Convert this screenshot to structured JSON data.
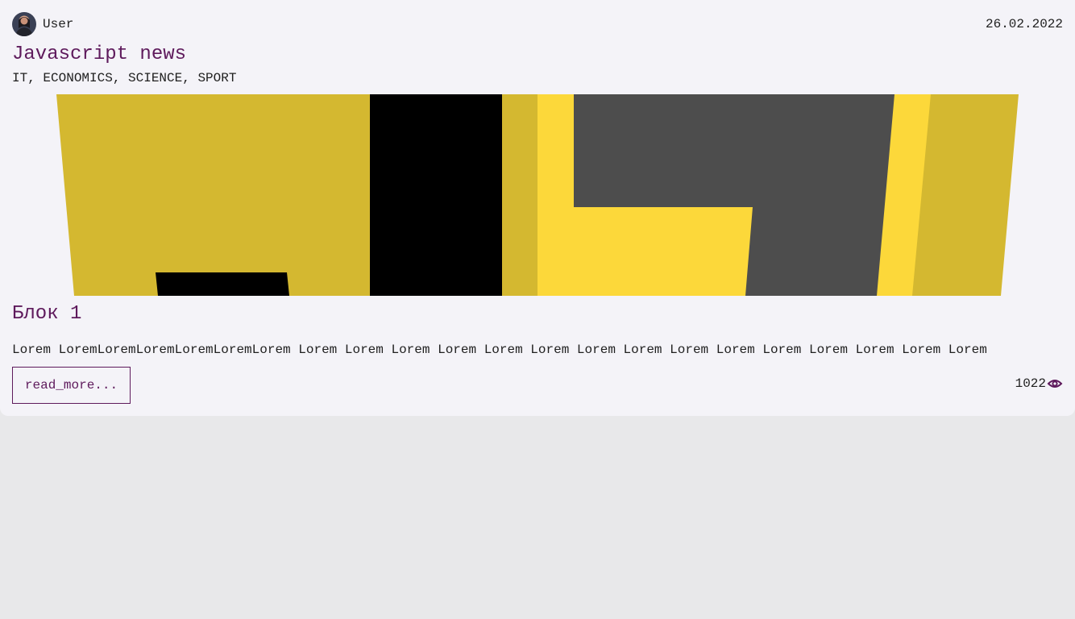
{
  "post": {
    "author": "User",
    "date": "26.02.2022",
    "title": "Javascript news",
    "tags": "IT, ECONOMICS, SCIENCE, SPORT",
    "block_title": "Блок 1",
    "text": "Lorem LoremLoremLoremLoremLoremLorem Lorem Lorem Lorem Lorem Lorem Lorem Lorem Lorem Lorem Lorem Lorem Lorem Lorem Lorem Lorem",
    "read_more_label": "read_more...",
    "views": "1022"
  },
  "icons": {
    "avatar": "avatar-image",
    "views": "eye-icon",
    "banner": "javascript-logo-image"
  },
  "colors": {
    "accent": "#5e1a5c",
    "banner_yellow": "#d4b830",
    "banner_bright_yellow": "#fcd83a",
    "banner_dark": "#4d4d4d",
    "background": "#e8e8ea",
    "card": "#f4f3f8"
  }
}
